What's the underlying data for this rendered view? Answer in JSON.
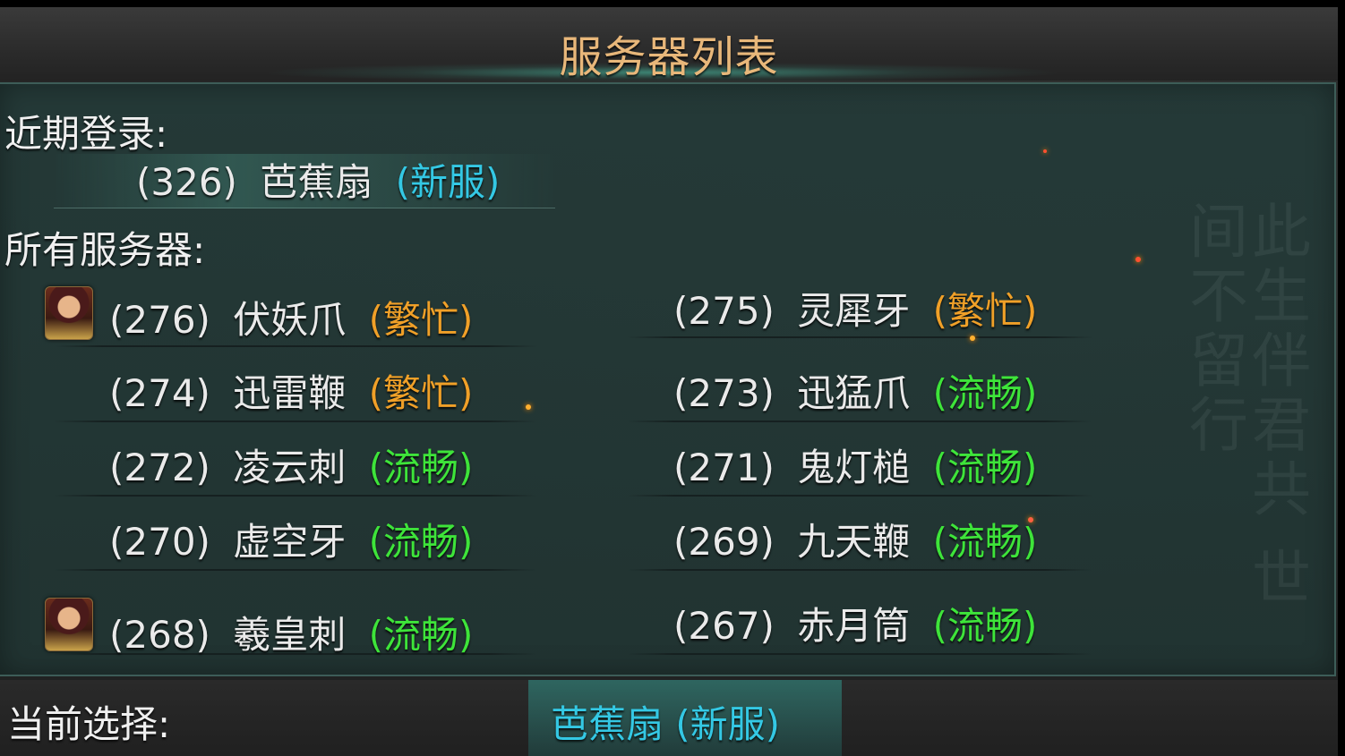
{
  "title": "服务器列表",
  "recent": {
    "label": "近期登录:",
    "server": {
      "id": "(326)",
      "name": "芭蕉扇",
      "status": "(新服)"
    }
  },
  "all": {
    "label": "所有服务器:",
    "servers": [
      {
        "id": "(276)",
        "name": "伏妖爪",
        "status": "(繁忙)",
        "status_type": "busy",
        "has_avatar": true
      },
      {
        "id": "(275)",
        "name": "灵犀牙",
        "status": "(繁忙)",
        "status_type": "busy",
        "has_avatar": false
      },
      {
        "id": "(274)",
        "name": "迅雷鞭",
        "status": "(繁忙)",
        "status_type": "busy",
        "has_avatar": false
      },
      {
        "id": "(273)",
        "name": "迅猛爪",
        "status": "(流畅)",
        "status_type": "smooth",
        "has_avatar": false
      },
      {
        "id": "(272)",
        "name": "凌云刺",
        "status": "(流畅)",
        "status_type": "smooth",
        "has_avatar": false
      },
      {
        "id": "(271)",
        "name": "鬼灯槌",
        "status": "(流畅)",
        "status_type": "smooth",
        "has_avatar": false
      },
      {
        "id": "(270)",
        "name": "虚空牙",
        "status": "(流畅)",
        "status_type": "smooth",
        "has_avatar": false
      },
      {
        "id": "(269)",
        "name": "九天鞭",
        "status": "(流畅)",
        "status_type": "smooth",
        "has_avatar": false
      },
      {
        "id": "(268)",
        "name": "羲皇刺",
        "status": "(流畅)",
        "status_type": "smooth",
        "has_avatar": true
      },
      {
        "id": "(267)",
        "name": "赤月筒",
        "status": "(流畅)",
        "status_type": "smooth",
        "has_avatar": false
      }
    ]
  },
  "current": {
    "label": "当前选择:",
    "value": "芭蕉扇 (新服)"
  },
  "colors": {
    "title": "#e8b77a",
    "new": "#34c8e4",
    "busy": "#f0a028",
    "smooth": "#3ee43a"
  }
}
